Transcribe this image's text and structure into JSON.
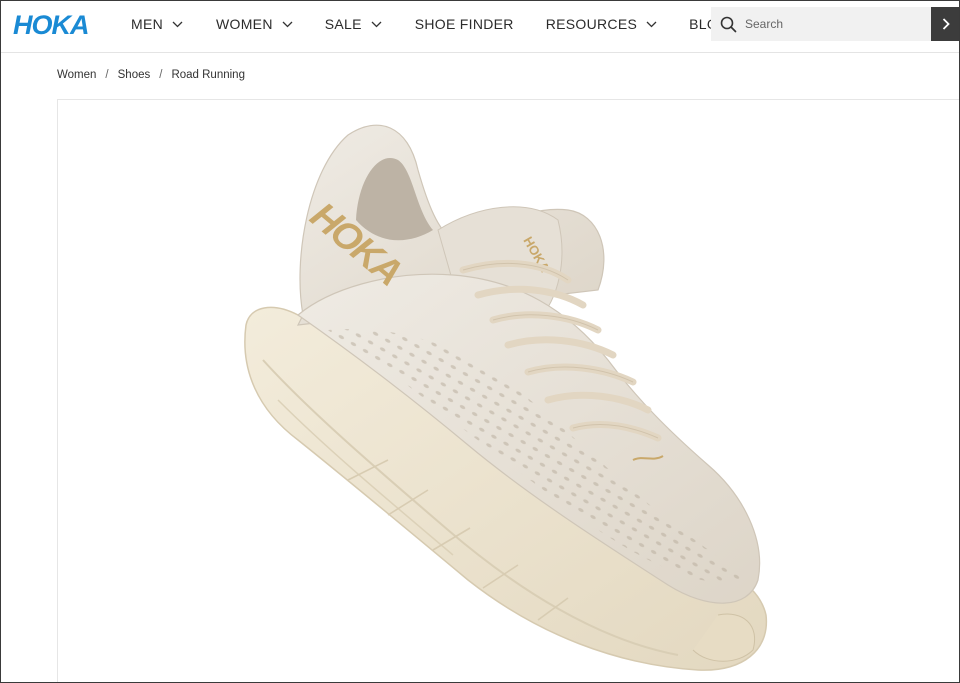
{
  "brand": {
    "logo_text": "HOKA",
    "logo_color": "#1a8ad4"
  },
  "nav": {
    "items": [
      {
        "label": "MEN",
        "has_dropdown": true
      },
      {
        "label": "WOMEN",
        "has_dropdown": true
      },
      {
        "label": "SALE",
        "has_dropdown": true
      },
      {
        "label": "SHOE FINDER",
        "has_dropdown": false
      },
      {
        "label": "RESOURCES",
        "has_dropdown": true
      },
      {
        "label": "BLOG",
        "has_dropdown": false
      }
    ]
  },
  "search": {
    "placeholder": "Search",
    "submit_icon": "chevron-right-icon"
  },
  "breadcrumb": {
    "items": [
      "Women",
      "Shoes",
      "Road Running"
    ],
    "separator": "/"
  },
  "product": {
    "image_alt": "Cream women's road running shoe with gold logo",
    "colors": {
      "upper": "#e8e2d8",
      "sole": "#efe6d2",
      "logo": "#c9a86a",
      "laces": "#e2d6c2"
    }
  }
}
